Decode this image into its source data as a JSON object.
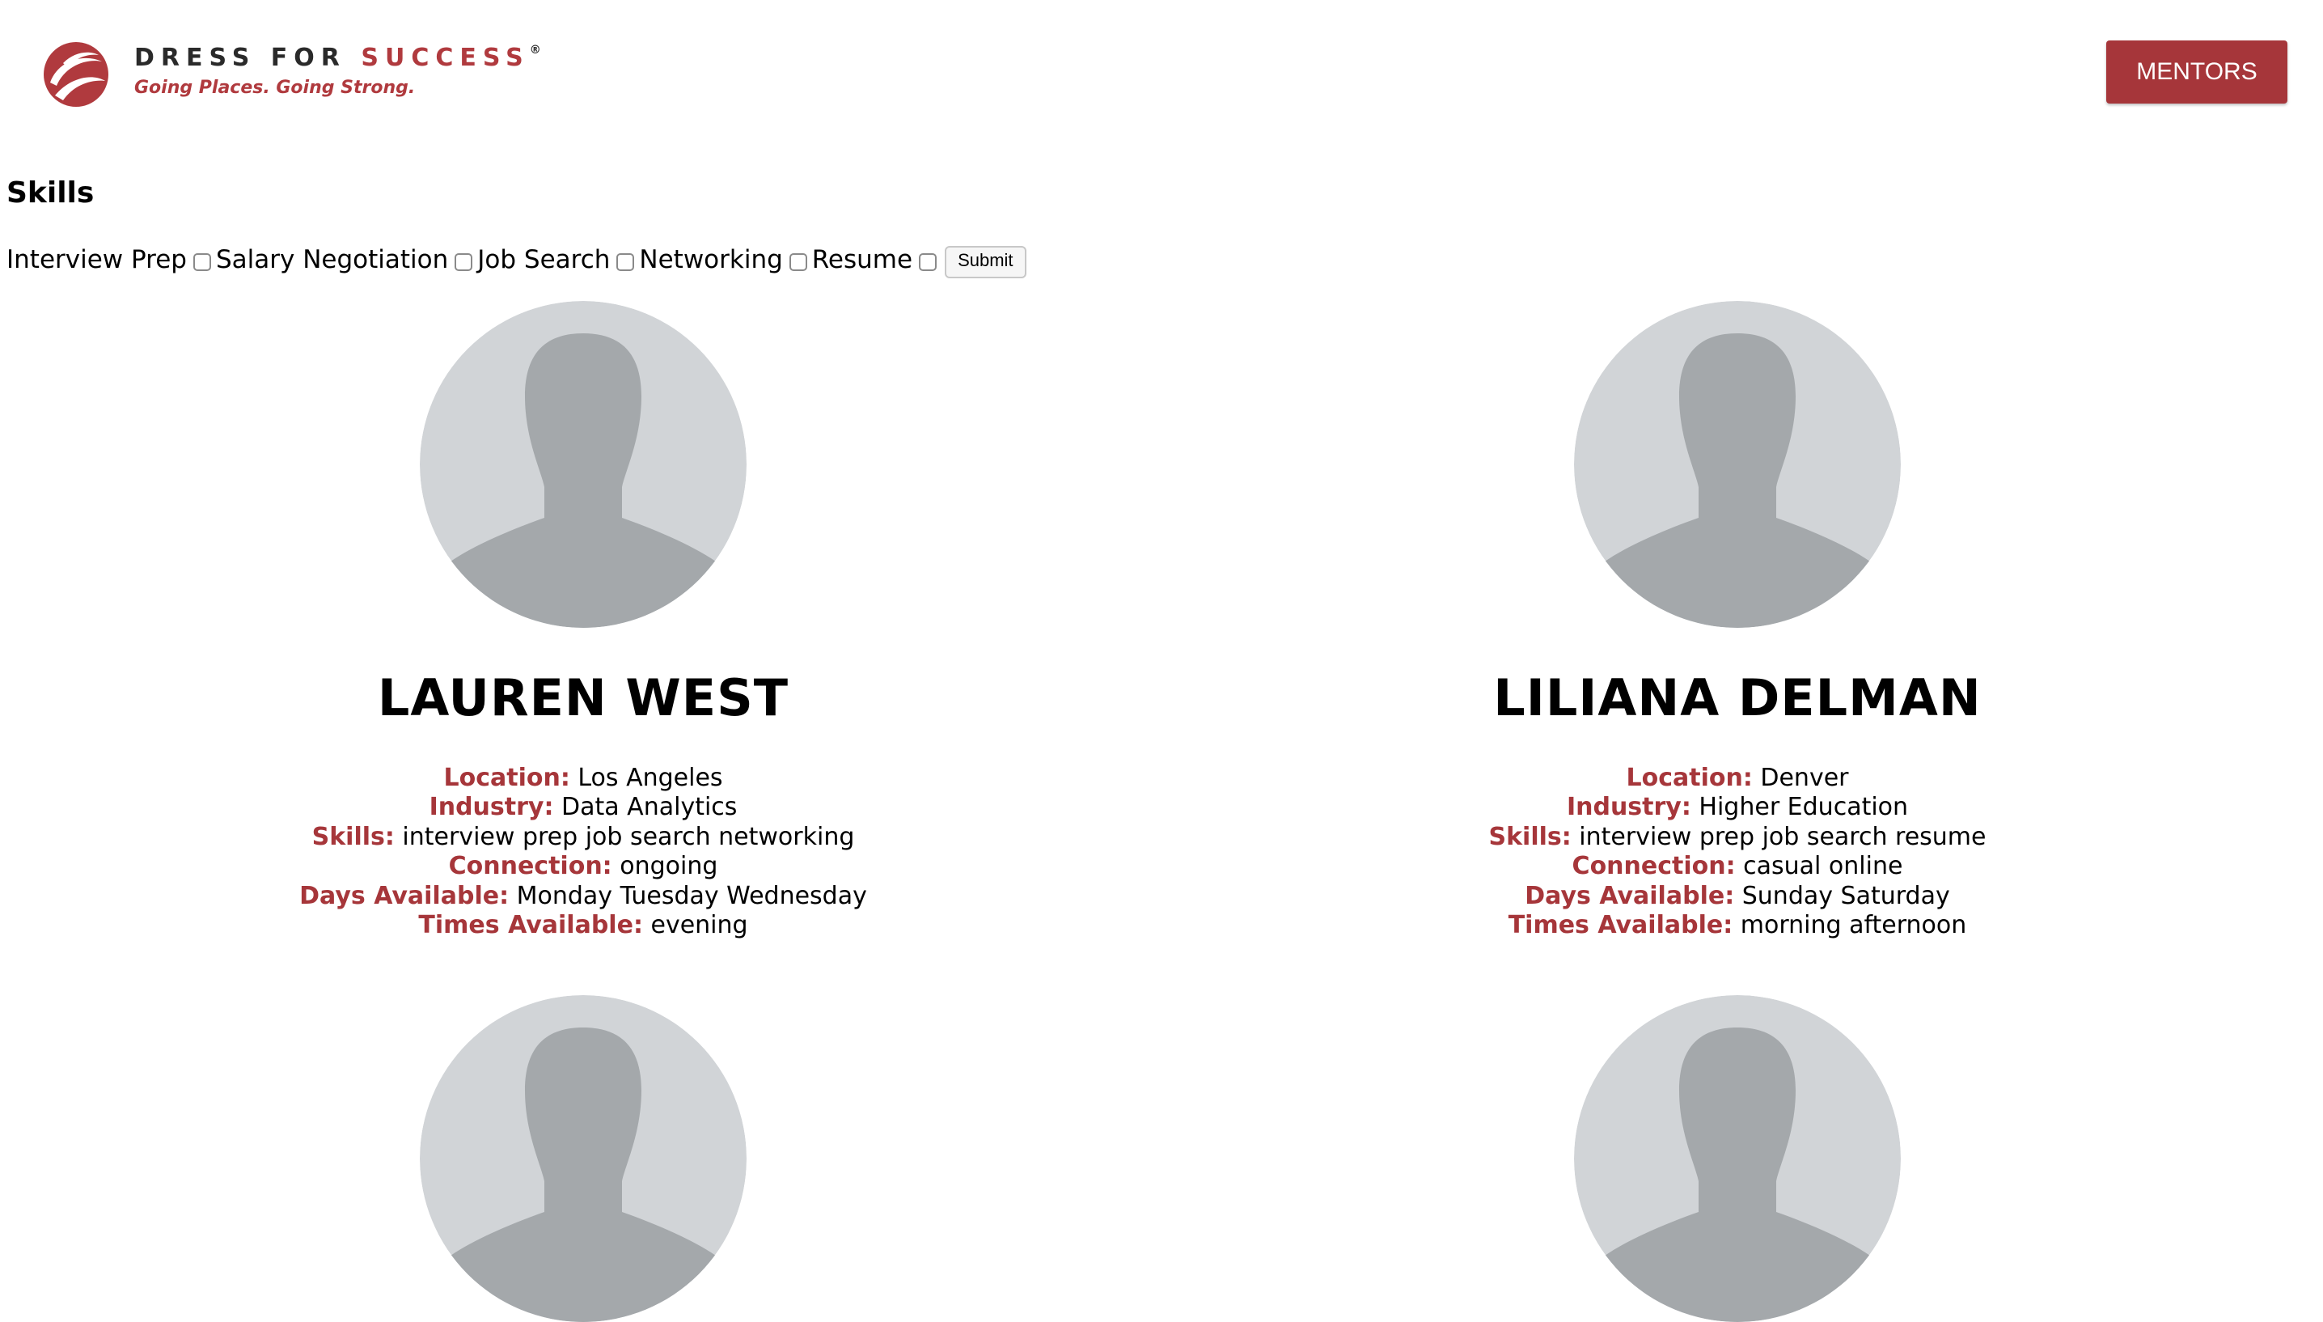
{
  "header": {
    "logo": {
      "brand_part1": "DRESS FOR ",
      "brand_part2": "SUCCESS",
      "registered": "®",
      "tagline": "Going Places. Going Strong."
    },
    "mentors_button": "MENTORS"
  },
  "filters": {
    "title": "Skills",
    "options": [
      {
        "label": "Interview Prep",
        "checked": false
      },
      {
        "label": "Salary Negotiation",
        "checked": false
      },
      {
        "label": "Job Search",
        "checked": false
      },
      {
        "label": "Networking",
        "checked": false
      },
      {
        "label": "Resume",
        "checked": false
      }
    ],
    "submit_label": "Submit"
  },
  "labels": {
    "location": "Location:",
    "industry": "Industry:",
    "skills": "Skills:",
    "connection": "Connection:",
    "days": "Days Available:",
    "times": "Times Available:"
  },
  "mentors": [
    {
      "name": "LAUREN WEST",
      "location": "Los Angeles",
      "industry": "Data Analytics",
      "skills": "interview prep job search networking",
      "connection": "ongoing",
      "days": "Monday Tuesday Wednesday",
      "times": "evening"
    },
    {
      "name": "LILIANA DELMAN",
      "location": "Denver",
      "industry": "Higher Education",
      "skills": "interview prep job search resume",
      "connection": "casual online",
      "days": "Sunday Saturday",
      "times": "morning afternoon"
    }
  ],
  "colors": {
    "accent": "#a6363a",
    "avatar_bg": "#d1d4d7",
    "avatar_silhouette": "#a4a8ab"
  }
}
